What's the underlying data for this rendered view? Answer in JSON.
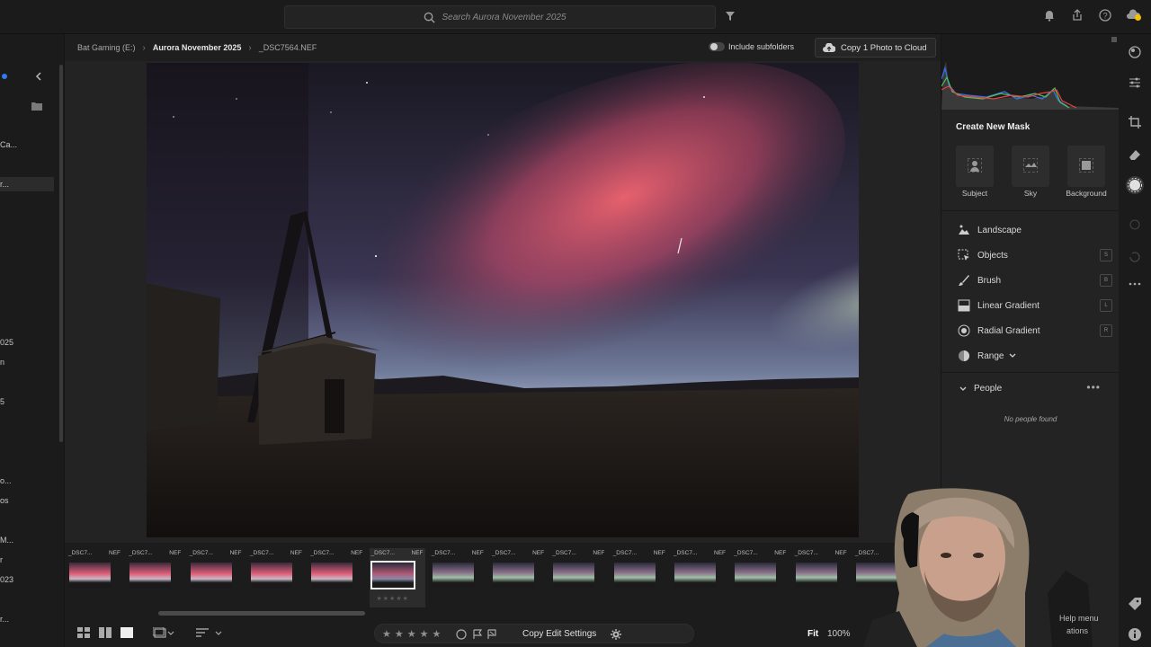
{
  "search": {
    "placeholder": "Search Aurora November 2025"
  },
  "breadcrumb": {
    "items": [
      "Bat Gaming (E:)",
      "Aurora November 2025",
      "_DSC7564.NEF"
    ]
  },
  "include_subfolders": {
    "label": "Include subfolders",
    "checked": false
  },
  "cloud_button": {
    "label": "Copy 1 Photo to Cloud"
  },
  "left_sidebar": {
    "items": [
      "Ca...",
      "r...",
      "025",
      "n",
      "5",
      "o...",
      "os",
      "M...",
      "r",
      "023",
      "r..."
    ]
  },
  "filmstrip": {
    "items": [
      {
        "name": "_DSC7...",
        "ext": "NEF"
      },
      {
        "name": "_DSC7...",
        "ext": "NEF"
      },
      {
        "name": "_DSC7...",
        "ext": "NEF"
      },
      {
        "name": "_DSC7...",
        "ext": "NEF"
      },
      {
        "name": "_DSC7...",
        "ext": "NEF"
      },
      {
        "name": "_DSC7...",
        "ext": "NEF"
      },
      {
        "name": "_DSC7...",
        "ext": "NEF"
      },
      {
        "name": "_DSC7...",
        "ext": "NEF"
      },
      {
        "name": "_DSC7...",
        "ext": "NEF"
      },
      {
        "name": "_DSC7...",
        "ext": "NEF"
      },
      {
        "name": "_DSC7...",
        "ext": "NEF"
      },
      {
        "name": "_DSC7...",
        "ext": "NEF"
      },
      {
        "name": "_DSC7...",
        "ext": "NEF"
      },
      {
        "name": "_DSC7...",
        "ext": "NEF"
      }
    ],
    "selected_index": 5
  },
  "bottombar": {
    "copy_edit_label": "Copy Edit Settings",
    "fit_label": "Fit",
    "zoom_label": "100%"
  },
  "right_panel": {
    "title": "Create New Mask",
    "mask_cards": [
      "Subject",
      "Sky",
      "Background"
    ],
    "tools": [
      {
        "label": "Landscape",
        "key": ""
      },
      {
        "label": "Objects",
        "key": "S"
      },
      {
        "label": "Brush",
        "key": "B"
      },
      {
        "label": "Linear Gradient",
        "key": "L"
      },
      {
        "label": "Radial Gradient",
        "key": "R"
      },
      {
        "label": "Range",
        "key": ""
      }
    ],
    "people_label": "People",
    "no_people_text": "No people found",
    "help_text_1": "Help menu",
    "help_text_2": "ations"
  },
  "colors": {
    "accent_blue": "#2d7cf0",
    "aurora_pink": "#e85a6e",
    "aurora_green": "#9fb89a",
    "notification_yellow": "#f2c200"
  }
}
